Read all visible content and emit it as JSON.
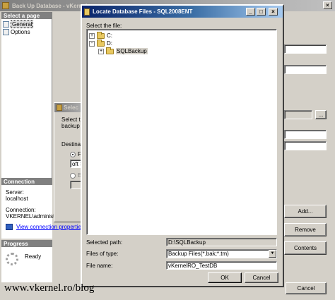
{
  "back_up_window": {
    "title": "Back Up Database - vKernel",
    "select_page_header": "Select a page",
    "pages": [
      {
        "label": "General"
      },
      {
        "label": "Options"
      }
    ],
    "connection_header": "Connection",
    "server_label": "Server:",
    "server_value": "localhost",
    "connection_label": "Connection:",
    "connection_value": "VKERNEL\\administra",
    "view_connection_link": "View connection properties",
    "progress_header": "Progress",
    "progress_status": "Ready",
    "add_button": "Add...",
    "remove_button": "Remove",
    "contents_button": "Contents",
    "cancel_button": "Cancel",
    "browse_button": "..."
  },
  "select_dialog": {
    "title": "Selec",
    "text_line1": "Select th",
    "text_line2": "backup d",
    "destination_label": "Destinati",
    "option_file_label": "F",
    "file_field_value": "oft S",
    "option_other_label": "E"
  },
  "locate_dialog": {
    "title": "Locate Database Files - SQL2008ENT",
    "select_file_label": "Select the file:",
    "tree": [
      {
        "label": "C:",
        "expander": "+"
      },
      {
        "label": "D:",
        "expander": "-"
      },
      {
        "label": "SQLBackup",
        "expander": "+"
      }
    ],
    "selected_path_label": "Selected path:",
    "selected_path_value": "D:\\SQLBackup",
    "files_of_type_label": "Files of type:",
    "files_of_type_value": "Backup Files(*.bak;*.tm)",
    "file_name_label": "File name:",
    "file_name_value": "vKernelRO_TestDB",
    "ok_button": "OK",
    "cancel_button": "Cancel"
  },
  "watermark": "www.vkernel.ro/blog"
}
